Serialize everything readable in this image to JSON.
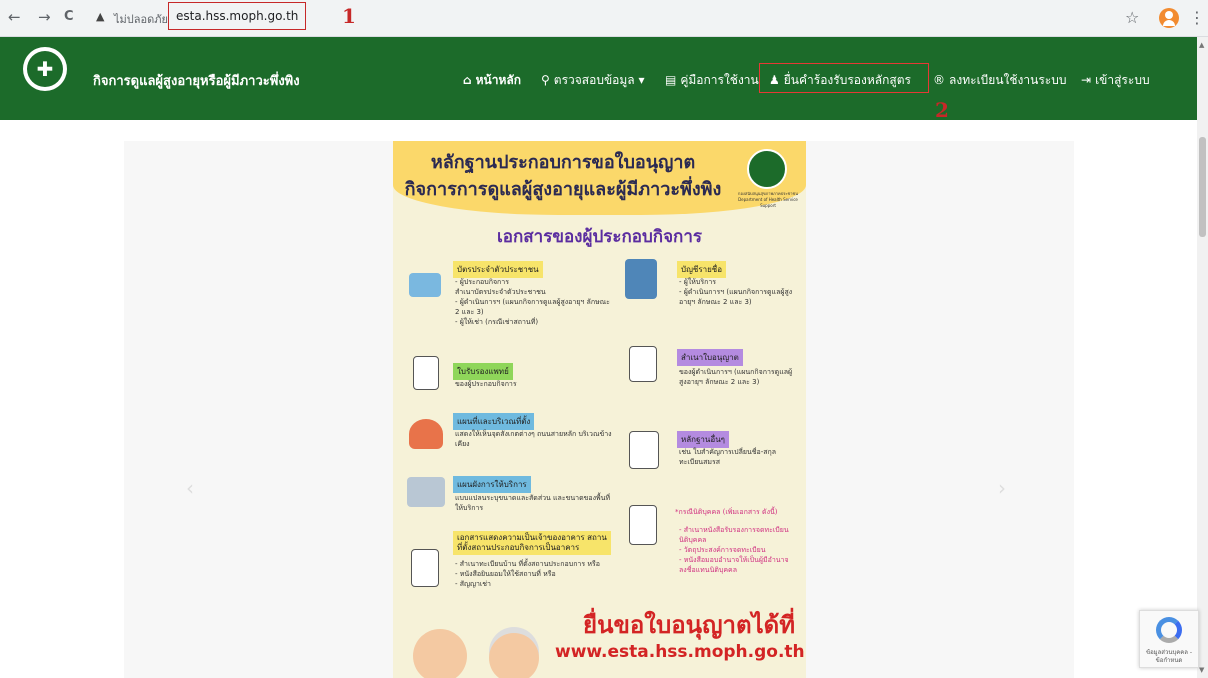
{
  "browser": {
    "back_icon": "←",
    "forward_icon": "→",
    "reload_icon": "C",
    "warning_icon": "▲",
    "security_text": "ไม่ปลอดภัย",
    "url": "esta.hss.moph.go.th",
    "star_icon": "☆",
    "menu_icon": "⋮"
  },
  "annotations": {
    "marker_1": "1",
    "marker_2": "2",
    "color": "#c62828"
  },
  "site": {
    "title": "กิจการดูแลผู้สูงอายุหรือผู้มีภาวะพึ่งพิง",
    "header_color": "#1c6b2a",
    "nav": [
      {
        "label": "หน้าหลัก",
        "icon": "home-icon",
        "glyph": "⌂"
      },
      {
        "label": "ตรวจสอบข้อมูล ▾",
        "icon": "search-icon",
        "glyph": "🔍"
      },
      {
        "label": "คู่มือการใช้งาน",
        "icon": "book-icon",
        "glyph": "▤"
      },
      {
        "label": "ยื่นคำร้องรับรองหลักสูตร",
        "icon": "users-icon",
        "glyph": "👥"
      },
      {
        "label": "ลงทะเบียนใช้งานระบบ",
        "icon": "registered-icon",
        "glyph": "®"
      },
      {
        "label": "เข้าสู่ระบบ",
        "icon": "sign-in-icon",
        "glyph": "⇥"
      }
    ]
  },
  "carousel": {
    "prev_icon": "‹",
    "next_icon": "›"
  },
  "poster": {
    "title_line1": "หลักฐานประกอบการขอใบอนุญาต",
    "title_line2": "กิจการการดูแลผู้สูงอายุและผู้มีภาวะพึ่งพิง",
    "logo_caption": "กองสนับสนุนสุขภาพภาคประชาชน Department of Health Service Support",
    "subtitle": "เอกสารของผู้ประกอบกิจการ",
    "items": [
      {
        "label": "บัตรประจำตัวประชาชน",
        "text": "- ผู้ประกอบกิจการ\nสำเนาบัตรประจำตัวประชาชน\n- ผู้ดำเนินการฯ (แผนกกิจการดูแลผู้สูงอายุฯ ลักษณะ 2 และ 3)\n- ผู้ให้เช่า (กรณีเช่าสถานที่)"
      },
      {
        "label": "ใบรับรองแพทย์",
        "text": "ของผู้ประกอบกิจการ"
      },
      {
        "label": "แผนที่และบริเวณที่ตั้ง",
        "text": "แสดงให้เห็นจุดสังเกตต่างๆ ถนนสายหลัก บริเวณข้างเคียง"
      },
      {
        "label": "แผนผังการให้บริการ",
        "text": "แบบแปลนระบุขนาดและสัดส่วน และขนาดของพื้นที่ให้บริการ"
      },
      {
        "label": "เอกสารแสดงความเป็นเจ้าของอาคาร สถานที่ตั้งสถานประกอบกิจการเป็นอาคาร",
        "text": "- สำเนาทะเบียนบ้าน ที่ตั้งสถานประกอบการ หรือ\n- หนังสือยินยอมให้ใช้สถานที่ หรือ\n- สัญญาเช่า"
      },
      {
        "label": "บัญชีรายชื่อ",
        "text": "- ผู้ให้บริการ\n- ผู้ดำเนินการฯ (แผนกกิจการดูแลผู้สูงอายุฯ ลักษณะ 2 และ 3)"
      },
      {
        "label": "สำเนาใบอนุญาต",
        "text": "ของผู้ดำเนินการฯ (แผนกกิจการดูแลผู้สูงอายุฯ ลักษณะ 2 และ 3)"
      },
      {
        "label": "หลักฐานอื่นๆ",
        "text": "เช่น ใบสำคัญการเปลี่ยนชื่อ-สกุล ทะเบียนสมรส"
      },
      {
        "label": "*กรณีนิติบุคคล (เพิ่มเอกสาร ดังนี้)",
        "text": "- สำเนาหนังสือรับรองการจดทะเบียนนิติบุคคล\n- วัตถุประสงค์การจดทะเบียน\n- หนังสือมอบอำนาจให้เป็นผู้มีอำนาจลงชื่อแทนนิติบุคคล"
      }
    ],
    "footer_line1": "ยื่นขอใบอนุญาตได้ที่",
    "footer_line2": "www.esta.hss.moph.go.th"
  },
  "recaptcha": {
    "text": "ข้อมูลส่วนบุคคล - ข้อกำหนด"
  }
}
